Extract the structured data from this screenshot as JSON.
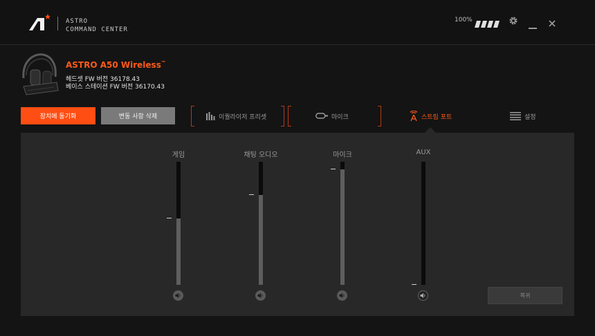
{
  "app": {
    "brand_line1": "ASTRO",
    "brand_line2": "COMMAND CENTER"
  },
  "titlebar": {
    "battery": "100%",
    "battery_level": 1.0
  },
  "device": {
    "name": "ASTRO A50 Wireless",
    "tm": "™",
    "headset_fw": "헤드셋 FW 버전 36178.43",
    "base_fw": "베이스 스테이션 FW 버전 36170.43"
  },
  "actions": {
    "sync": "장치에 동기화",
    "discard": "변동 사항 삭제"
  },
  "tabs": [
    {
      "label": "이퀄라이저 프리셋",
      "icon": "equalizer-icon"
    },
    {
      "label": "마이크",
      "icon": "microphone-icon"
    },
    {
      "label": "스트림 포트",
      "icon": "stream-tower-icon",
      "active": true
    },
    {
      "label": "설정",
      "icon": "settings-list-icon"
    }
  ],
  "channels": [
    {
      "label": "게임",
      "level": 0.54,
      "muted": false
    },
    {
      "label": "채팅 오디오",
      "level": 0.73,
      "muted": false
    },
    {
      "label": "마이크",
      "level": 0.94,
      "muted": false
    },
    {
      "label": "AUX",
      "level": 0.0,
      "muted": true
    }
  ],
  "reset": "복귀",
  "colors": {
    "accent": "#ff4e14",
    "panel": "#282828"
  }
}
